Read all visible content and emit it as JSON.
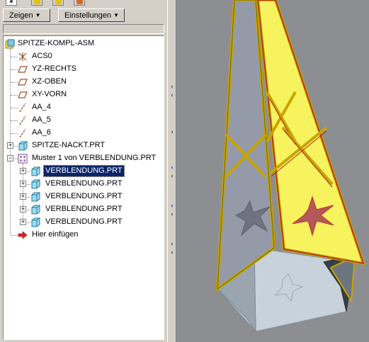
{
  "toolbar": {
    "show_label": "Zeigen",
    "settings_label": "Einstellungen"
  },
  "tree": {
    "root": "SPITZE-KOMPL-ASM",
    "items": [
      {
        "label": "ACS0",
        "icon": "csys-icon"
      },
      {
        "label": "YZ-RECHTS",
        "icon": "datum-plane-icon"
      },
      {
        "label": "XZ-OBEN",
        "icon": "datum-plane-icon"
      },
      {
        "label": "XY-VORN",
        "icon": "datum-plane-icon"
      },
      {
        "label": "AA_4",
        "icon": "datum-axis-icon"
      },
      {
        "label": "AA_5",
        "icon": "datum-axis-icon"
      },
      {
        "label": "AA_6",
        "icon": "datum-axis-icon"
      },
      {
        "label": "SPITZE-NACKT.PRT",
        "icon": "part-icon"
      },
      {
        "label": "Muster 1 von VERBLENDUNG.PRT",
        "icon": "pattern-icon"
      }
    ],
    "pattern_children": [
      {
        "label": "VERBLENDUNG.PRT",
        "selected": true
      },
      {
        "label": "VERBLENDUNG.PRT",
        "selected": false
      },
      {
        "label": "VERBLENDUNG.PRT",
        "selected": false
      },
      {
        "label": "VERBLENDUNG.PRT",
        "selected": false
      },
      {
        "label": "VERBLENDUNG.PRT",
        "selected": false
      }
    ],
    "insert_here": "Hier einfügen"
  },
  "colors": {
    "panel_bg": "#d4d0c8",
    "selection": "#0a246a",
    "viewport_bg": "#8d8e91",
    "cladding_yellow": "#f5f06a",
    "cladding_edge": "#c8a400",
    "cut_red": "#c0392b",
    "body_grey": "#a6b0bc"
  }
}
